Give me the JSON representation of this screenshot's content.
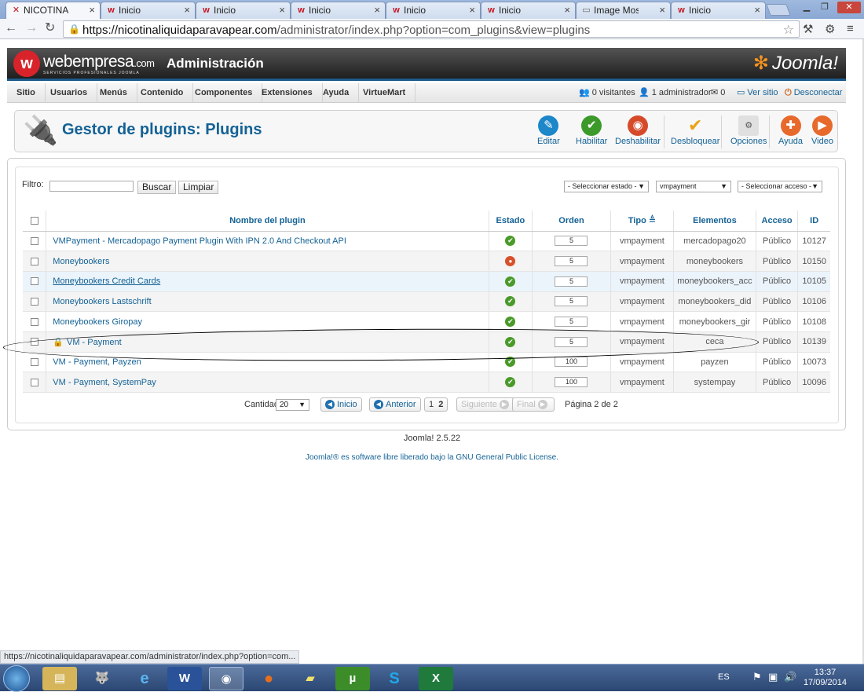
{
  "browser": {
    "tabs": [
      {
        "label": "NICOTINALIQUI",
        "active": true
      },
      {
        "label": "Inicio"
      },
      {
        "label": "Inicio"
      },
      {
        "label": "Inicio"
      },
      {
        "label": "Inicio"
      },
      {
        "label": "Inicio"
      },
      {
        "label": "Image Mostrar C"
      },
      {
        "label": "Inicio"
      }
    ],
    "url_host": "https://nicotinaliquidaparavapear.com",
    "url_path": "/administrator/index.php?option=com_plugins&view=plugins",
    "status_url": "https://nicotinaliquidaparavapear.com/administrator/index.php?option=com..."
  },
  "header": {
    "brand": "webempresa",
    "brand_suffix": ".com",
    "brand_sub": "SERVICIOS PROFESIONALES JOOMLA",
    "admin_title": "Administración",
    "cms_name": "Joomla!"
  },
  "menu": {
    "items": [
      "Sitio",
      "Usuarios",
      "Menús",
      "Contenido",
      "Componentes",
      "Extensiones",
      "Ayuda",
      "VirtueMart"
    ],
    "visitors": "0 visitantes",
    "admins": "1 administrador",
    "messages": "0",
    "view_site": "Ver sitio",
    "logout": "Desconectar"
  },
  "toolbar": {
    "title": "Gestor de plugins: Plugins",
    "edit": "Editar",
    "enable": "Habilitar",
    "disable": "Deshabilitar",
    "unlock": "Desbloquear",
    "options": "Opciones",
    "help": "Ayuda",
    "video": "Video"
  },
  "filters": {
    "label": "Filtro:",
    "value": "",
    "search_btn": "Buscar",
    "clear_btn": "Limpiar",
    "state_select": "- Seleccionar estado -",
    "type_select": "vmpayment",
    "access_select": "- Seleccionar acceso -"
  },
  "table": {
    "headers": {
      "name": "Nombre del plugin",
      "state": "Estado",
      "order": "Orden",
      "type": "Tipo",
      "elements": "Elementos",
      "access": "Acceso",
      "id": "ID"
    },
    "rows": [
      {
        "name": "VMPayment - Mercadopago Payment Plugin With IPN 2.0 And Checkout API",
        "enabled": true,
        "order": "5",
        "type": "vmpayment",
        "element": "mercadopago20",
        "access": "Público",
        "id": "10127"
      },
      {
        "name": "Moneybookers",
        "enabled": false,
        "order": "5",
        "type": "vmpayment",
        "element": "moneybookers",
        "access": "Público",
        "id": "10150"
      },
      {
        "name": "Moneybookers Credit Cards",
        "enabled": true,
        "order": "5",
        "type": "vmpayment",
        "element": "moneybookers_acc",
        "access": "Público",
        "id": "10105",
        "hover": true
      },
      {
        "name": "Moneybookers Lastschrift",
        "enabled": true,
        "order": "5",
        "type": "vmpayment",
        "element": "moneybookers_did",
        "access": "Público",
        "id": "10106"
      },
      {
        "name": "Moneybookers Giropay",
        "enabled": true,
        "order": "5",
        "type": "vmpayment",
        "element": "moneybookers_gir",
        "access": "Público",
        "id": "10108"
      },
      {
        "name": "VM - Payment",
        "enabled": true,
        "order": "5",
        "type": "vmpayment",
        "element": "ceca",
        "access": "Público",
        "id": "10139",
        "locked": true
      },
      {
        "name": "VM - Payment, Payzen",
        "enabled": true,
        "order": "100",
        "type": "vmpayment",
        "element": "payzen",
        "access": "Público",
        "id": "10073"
      },
      {
        "name": "VM - Payment, SystemPay",
        "enabled": true,
        "order": "100",
        "type": "vmpayment",
        "element": "systempay",
        "access": "Público",
        "id": "10096"
      }
    ]
  },
  "pager": {
    "quantity_label": "Cantidad",
    "quantity_value": "20",
    "start": "Inicio",
    "prev": "Anterior",
    "page1": "1",
    "page2": "2",
    "next": "Siguiente",
    "last": "Final",
    "page_info": "Página 2 de 2"
  },
  "footer": {
    "version": "Joomla! 2.5.22",
    "license_pre": "Joomla!® es software libre liberado bajo la",
    "license_link": "GNU General Public License."
  },
  "taskbar": {
    "lang": "ES",
    "time": "13:37",
    "date": "17/09/2014"
  }
}
